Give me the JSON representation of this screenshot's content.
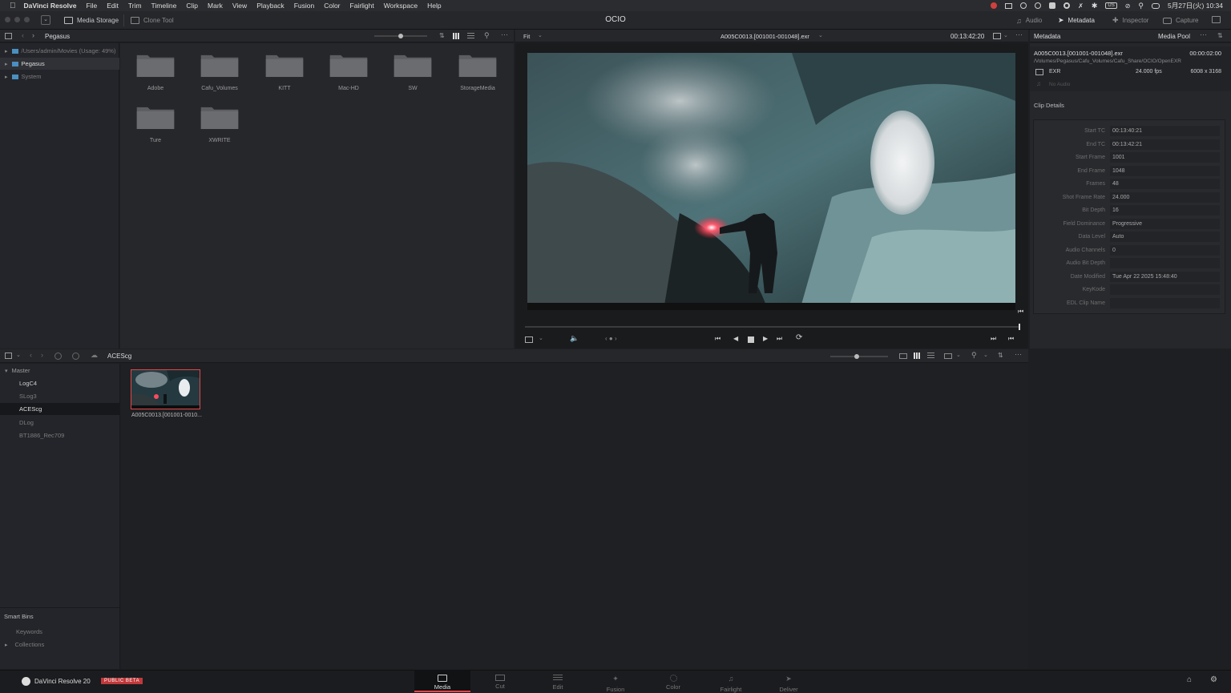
{
  "menubar": {
    "app_name": "DaVinci Resolve",
    "items": [
      "File",
      "Edit",
      "Trim",
      "Timeline",
      "Clip",
      "Mark",
      "View",
      "Playback",
      "Fusion",
      "Color",
      "Fairlight",
      "Workspace",
      "Help"
    ],
    "clock": "5月27日(火)  10:34",
    "input_source": "US"
  },
  "topbar": {
    "media_storage": "Media Storage",
    "clone_tool": "Clone Tool",
    "project_title": "OCIO",
    "audio": "Audio",
    "metadata": "Metadata",
    "inspector": "Inspector",
    "capture": "Capture"
  },
  "media_storage": {
    "location": "Pegasus",
    "tree": [
      {
        "label": "/Users/admin/Movies (Usage: 49%)",
        "selected": false
      },
      {
        "label": "Pegasus",
        "selected": true
      },
      {
        "label": "System",
        "selected": false
      }
    ],
    "folders": [
      "Adobe",
      "Cafu_Volumes",
      "KITT",
      "Mac-HD",
      "SW",
      "StorageMedia",
      "Ture",
      "XWRITE"
    ]
  },
  "viewer": {
    "zoom": "Fit",
    "clip_name": "A005C0013.[001001-001048].exr",
    "timecode": "00:13:42:20"
  },
  "metadata_panel": {
    "title": "Metadata",
    "media_pool_label": "Media Pool",
    "clip_file": "A005C0013.[001001-001048].exr",
    "duration": "00:00:02:00",
    "path": "/Volumes/Pegasus/Cafu_Volumes/Cafu_Share/OCIO/OpenEXR",
    "format": "EXR",
    "fps": "24.000 fps",
    "resolution": "6008 x 3168",
    "audio": "No Audio",
    "section": "Clip Details",
    "rows": [
      {
        "key": "Start TC",
        "value": "00:13:40:21"
      },
      {
        "key": "End TC",
        "value": "00:13:42:21"
      },
      {
        "key": "Start Frame",
        "value": "1001"
      },
      {
        "key": "End Frame",
        "value": "1048"
      },
      {
        "key": "Frames",
        "value": "48"
      },
      {
        "key": "Shot Frame Rate",
        "value": "24.000"
      },
      {
        "key": "Bit Depth",
        "value": "16"
      },
      {
        "key": "Field Dominance",
        "value": "Progressive"
      },
      {
        "key": "Data Level",
        "value": "Auto"
      },
      {
        "key": "Audio Channels",
        "value": "0"
      },
      {
        "key": "Audio Bit Depth",
        "value": ""
      },
      {
        "key": "Date Modified",
        "value": "Tue Apr 22 2025 15:48:40"
      },
      {
        "key": "KeyKode",
        "value": ""
      },
      {
        "key": "EDL Clip Name",
        "value": ""
      }
    ]
  },
  "media_pool": {
    "current_bin": "ACEScg",
    "bins": [
      {
        "label": "Master",
        "level": 0,
        "selected": false
      },
      {
        "label": "LogC4",
        "level": 1,
        "selected": false
      },
      {
        "label": "SLog3",
        "level": 1,
        "selected": false
      },
      {
        "label": "ACEScg",
        "level": 1,
        "selected": true
      },
      {
        "label": "DLog",
        "level": 1,
        "selected": false
      },
      {
        "label": "BT1886_Rec709",
        "level": 1,
        "selected": false
      }
    ],
    "smart_bins_title": "Smart Bins",
    "smart_bins": [
      "Keywords",
      "Collections"
    ],
    "clips": [
      {
        "label": "A005C0013.[001001-0010..."
      }
    ]
  },
  "bottom_bar": {
    "product": "DaVinci Resolve 20",
    "badge": "PUBLIC BETA",
    "pages": [
      "Media",
      "Cut",
      "Edit",
      "Fusion",
      "Color",
      "Fairlight",
      "Deliver"
    ],
    "active_page": "Media"
  },
  "colors": {
    "accent_red": "#e0464a",
    "badge_red": "#c0393b",
    "panel_bg": "#26272b",
    "app_bg": "#1e1f22"
  }
}
